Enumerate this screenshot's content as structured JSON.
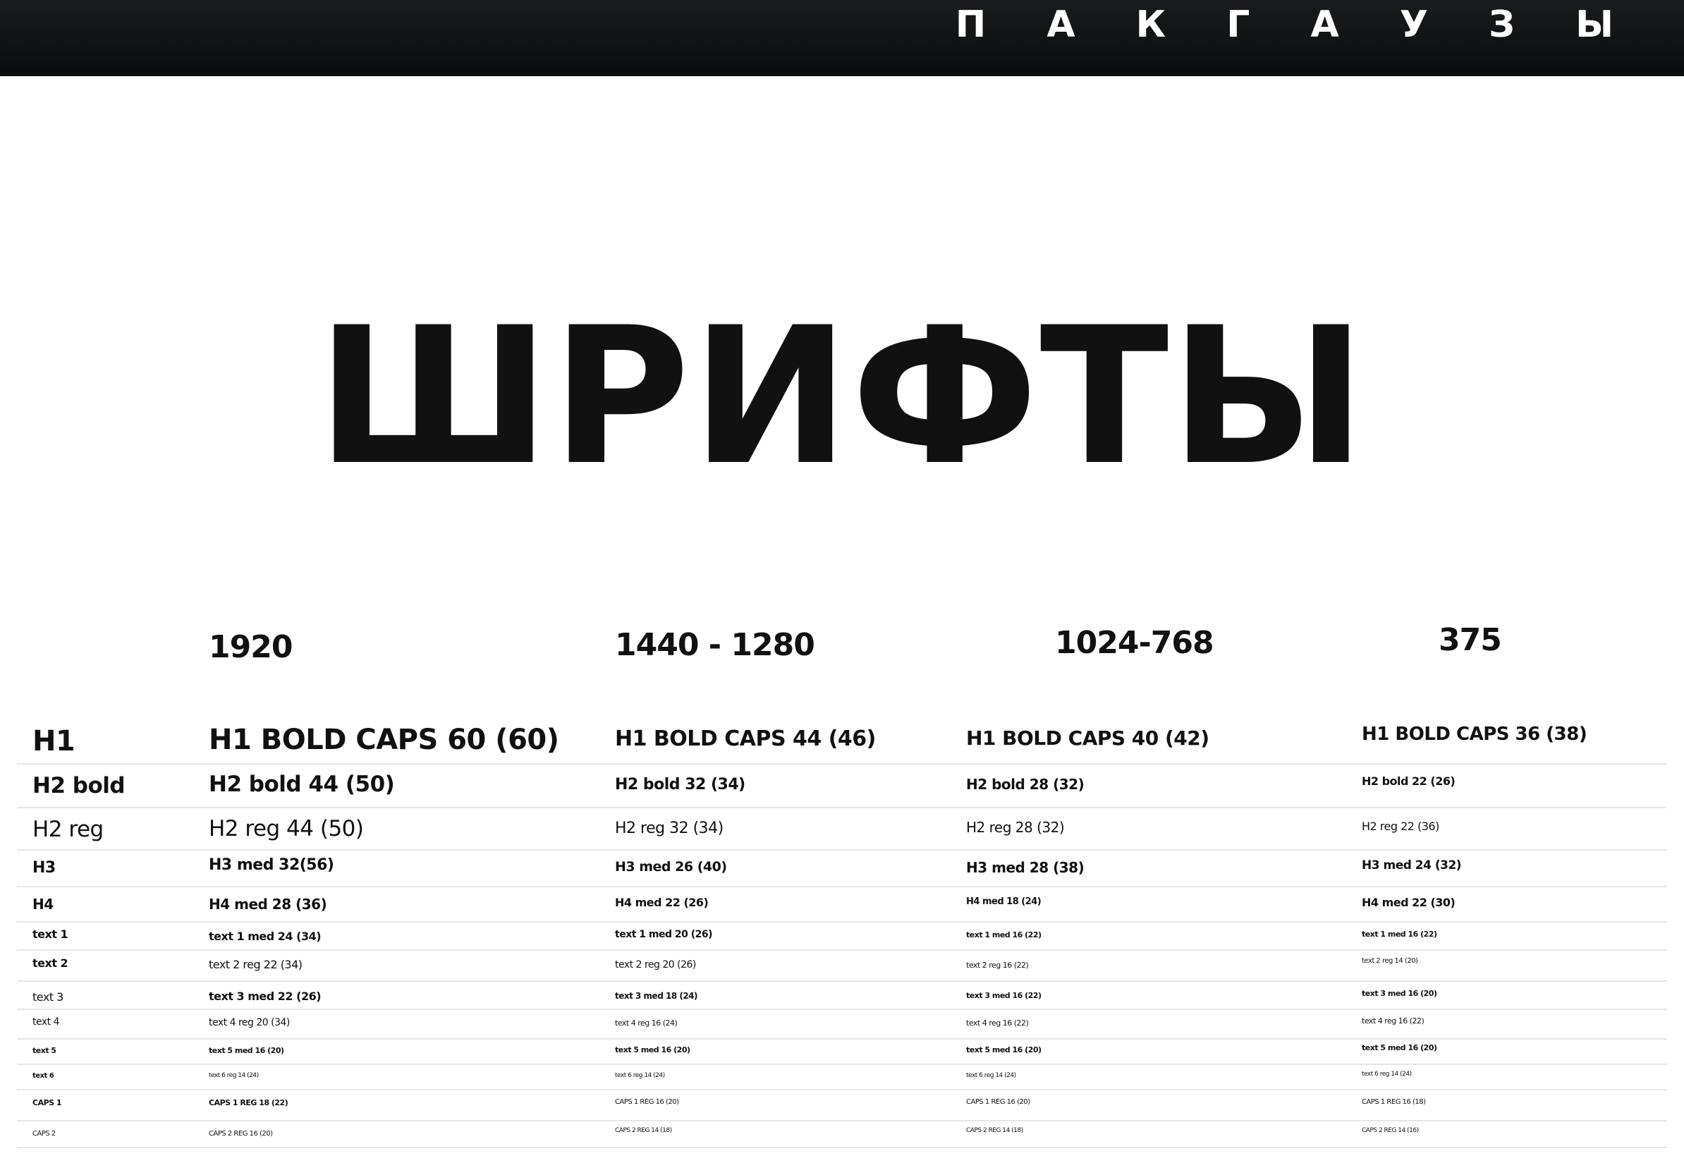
{
  "header": {
    "brand": "П А К Г А У З Ы"
  },
  "hero": {
    "title": "ШРИФТЫ"
  },
  "columns": [
    "1920",
    "1440 - 1280",
    "1024-768",
    "375"
  ],
  "rows": [
    {
      "label": "H1",
      "cells": [
        "H1  BOLD CAPS 60 (60)",
        "H1 BOLD CAPS 44 (46)",
        "H1 BOLD CAPS 40 (42)",
        "H1 BOLD CAPS 36 (38)"
      ]
    },
    {
      "label": "H2 bold",
      "cells": [
        "H2  bold 44 (50)",
        "H2 bold 32 (34)",
        "H2 bold  28 (32)",
        "H2 bold  22 (26)"
      ]
    },
    {
      "label": "H2 reg",
      "cells": [
        "H2 reg 44 (50)",
        "H2 reg 32 (34)",
        "H2 reg 28 (32)",
        "H2 reg 22 (36)"
      ]
    },
    {
      "label": "H3",
      "cells": [
        "H3  med 32(56)",
        "H3 med 26 (40)",
        "H3 med 28 (38)",
        "H3 med 24 (32)"
      ]
    },
    {
      "label": "H4",
      "cells": [
        "H4 med 28 (36)",
        "H4 med 22 (26)",
        "H4 med 18 (24)",
        "H4 med 22 (30)"
      ]
    },
    {
      "label": "text 1",
      "cells": [
        "text 1  med 24 (34)",
        "text 1 med  20 (26)",
        "text 1 med 16 (22)",
        "text 1 med 16 (22)"
      ]
    },
    {
      "label": "text 2",
      "cells": [
        "text 2  reg 22 (34)",
        "text 2 reg  20 (26)",
        "text 2 reg  16 (22)",
        "text 2 reg  14 (20)"
      ]
    },
    {
      "label": "text 3",
      "cells": [
        "text 3  med 22 (26)",
        "text 3 med 18 (24)",
        "text 3 med 16 (22)",
        "text 3 med 16 (20)"
      ]
    },
    {
      "label": "text 4",
      "cells": [
        "text 4  reg  20 (34)",
        "text 4 reg  16 (24)",
        "text 4 reg  16 (22)",
        "text 4 reg  16 (22)"
      ]
    },
    {
      "label": "text 5",
      "cells": [
        "text 5  med  16 (20)",
        "text 5 med  16 (20)",
        "text 5 med  16 (20)",
        "text 5 med  16 (20)"
      ]
    },
    {
      "label": "text 6",
      "cells": [
        "text 6 reg  14 (24)",
        "text 6 reg  14 (24)",
        "text 6 reg  14 (24)",
        "text 6 reg  14 (24)"
      ]
    },
    {
      "label": "CAPS 1",
      "cells": [
        "CAPS 1  REG 18 (22)",
        "CAPS 1  REG  16 (20)",
        "CAPS 1  REG  16 (20)",
        "CAPS 1  REG  16 (18)"
      ]
    },
    {
      "label": "CAPS 2",
      "cells": [
        "CAPS 2  REG 16 (20)",
        "CAPS 2  REG  14 (18)",
        "CAPS 2  REG  14 (18)",
        "CAPS 2  REG  14 (16)"
      ]
    }
  ]
}
